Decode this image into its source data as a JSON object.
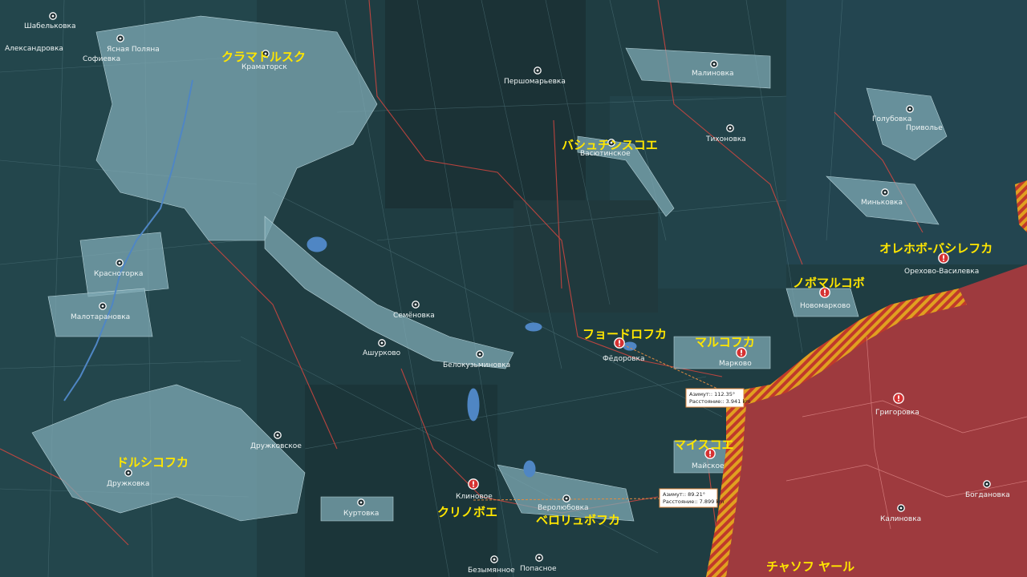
{
  "colors": {
    "background": "#1e3a3f",
    "urban": "#7fa9b4",
    "front_line": "#c9302c",
    "occupied": "#b03a3e",
    "hatch": "#e0a020",
    "jp_label": "#ffe600"
  },
  "settlements": [
    {
      "id": "shabelkovka",
      "name": "Шабельковка"
    },
    {
      "id": "aleksandrovka",
      "name": "Александровка"
    },
    {
      "id": "yasnaya_polyana",
      "name": "Ясная Поляна"
    },
    {
      "id": "sofievka",
      "name": "Софиевка"
    },
    {
      "id": "kramatorsk",
      "name": "Краматорск"
    },
    {
      "id": "pershomarevka",
      "name": "Першомарьевка"
    },
    {
      "id": "malinovka",
      "name": "Малиновка"
    },
    {
      "id": "golubovka",
      "name": "Голубовка"
    },
    {
      "id": "privolye",
      "name": "Приволье"
    },
    {
      "id": "tikhonovka",
      "name": "Тихоновка"
    },
    {
      "id": "vasyutinskoe",
      "name": "Васютинское"
    },
    {
      "id": "minkovka",
      "name": "Миньковка"
    },
    {
      "id": "orekhovo",
      "name": "Орехово-Василевка"
    },
    {
      "id": "krasnotorka",
      "name": "Красноторка"
    },
    {
      "id": "malotaranovka",
      "name": "Малотарановка"
    },
    {
      "id": "semenovka",
      "name": "Семёновка"
    },
    {
      "id": "novomarkovo",
      "name": "Новомарково"
    },
    {
      "id": "ashurkovo",
      "name": "Ашурково"
    },
    {
      "id": "belokuzminovka",
      "name": "Белокузьминовка"
    },
    {
      "id": "fedorovka",
      "name": "Фёдоровка"
    },
    {
      "id": "markovo",
      "name": "Марково"
    },
    {
      "id": "grigorovka",
      "name": "Григоровка"
    },
    {
      "id": "druzhkovskoe",
      "name": "Дружковское"
    },
    {
      "id": "maiskoe",
      "name": "Майское"
    },
    {
      "id": "druzhkovka",
      "name": "Дружковка"
    },
    {
      "id": "klinovoe",
      "name": "Клиновое"
    },
    {
      "id": "kurtovka",
      "name": "Куртовка"
    },
    {
      "id": "verolyubovka",
      "name": "Веролюбовка"
    },
    {
      "id": "bogdanovka",
      "name": "Богдановка"
    },
    {
      "id": "kalinovka",
      "name": "Калиновка"
    },
    {
      "id": "bezymyannoe",
      "name": "Безымянное"
    },
    {
      "id": "popasnoe",
      "name": "Попасное"
    }
  ],
  "japanese_labels": [
    {
      "id": "kramatorsk_jp",
      "text": "クラマトルスク"
    },
    {
      "id": "vasyutinskoe_jp",
      "text": "バシュチンスコエ"
    },
    {
      "id": "orekhovo_jp",
      "text": "オレホボ-バシレフカ"
    },
    {
      "id": "novomarkovo_jp",
      "text": "ノボマルコボ"
    },
    {
      "id": "fedorovka_jp",
      "text": "フョードロフカ"
    },
    {
      "id": "markovo_jp",
      "text": "マルコフカ"
    },
    {
      "id": "maiskoe_jp",
      "text": "マイスコエ"
    },
    {
      "id": "druzhkovka_jp",
      "text": "ドルシコフカ"
    },
    {
      "id": "klinovoe_jp",
      "text": "クリノボエ"
    },
    {
      "id": "verolyubovka_jp",
      "text": "ベロリュボフカ"
    },
    {
      "id": "chasov_yar_jp",
      "text": "チャソフ ヤール"
    }
  ],
  "measurements": [
    {
      "id": "m1",
      "azimuth": "Азимут:: 112.35° ",
      "distance": "Расстояние:: 3.941 km"
    },
    {
      "id": "m2",
      "azimuth": "Азимут:: 89.21° ",
      "distance": "Расстояние:: 7.899 km"
    }
  ]
}
